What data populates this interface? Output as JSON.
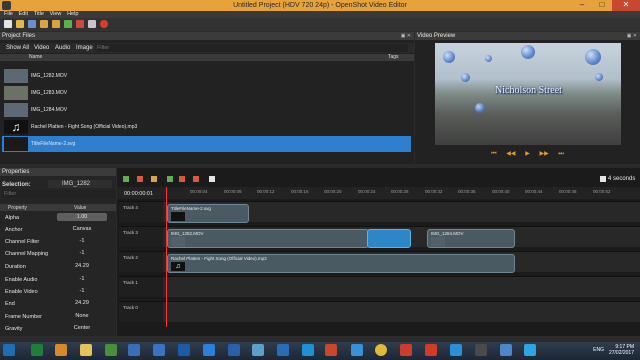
{
  "window": {
    "title": "Untitled Project (HDV 720 24p) - OpenShot Video Editor",
    "minimize": "–",
    "maximize": "□",
    "close": "✕"
  },
  "menu": {
    "file": "File",
    "edit": "Edit",
    "title": "Title",
    "view": "View",
    "help": "Help"
  },
  "project_files": {
    "header": "Project Files",
    "tabs": [
      "Show All",
      "Video",
      "Audio",
      "Image"
    ],
    "filter_placeholder": "Filter",
    "columns": {
      "name": "Name",
      "tags": "Tags"
    },
    "items": [
      "IMG_1282.MOV",
      "IMG_1283.MOV",
      "IMG_1284.MOV",
      "Rachel Platten - Fight Song (Official Video).mp3",
      "TitleFileName-2.svg"
    ]
  },
  "video_preview": {
    "header": "Video Preview",
    "overlay_text": "Nicholson Street",
    "transport": [
      "⏮",
      "◀◀",
      "▶",
      "▶▶",
      "⏭"
    ]
  },
  "properties": {
    "header": "Properties",
    "selection_label": "Selection:",
    "selection_value": "IMG_1282",
    "filter_placeholder": "Filter",
    "columns": {
      "property": "Property",
      "value": "Value"
    },
    "rows": [
      {
        "k": "Alpha",
        "v": "1.00"
      },
      {
        "k": "Anchor",
        "v": "Canvas"
      },
      {
        "k": "Channel Filter",
        "v": "-1"
      },
      {
        "k": "Channel Mapping",
        "v": "-1"
      },
      {
        "k": "Duration",
        "v": "24.29"
      },
      {
        "k": "Enable Audio",
        "v": "-1"
      },
      {
        "k": "Enable Video",
        "v": "-1"
      },
      {
        "k": "End",
        "v": "24.29"
      },
      {
        "k": "Frame Number",
        "v": "None"
      },
      {
        "k": "Gravity",
        "v": "Center"
      }
    ]
  },
  "timeline": {
    "zoom_label": "4 seconds",
    "timecode": "00:00:00:01",
    "ticks": [
      "00:00:04",
      "00:00:08",
      "00:00:12",
      "00:00:16",
      "00:00:20",
      "00:00:24",
      "00:00:28",
      "00:00:32",
      "00:00:36",
      "00:00:40",
      "00:00:44",
      "00:00:48",
      "00:00:52"
    ],
    "tracks": [
      {
        "name": "Track 4",
        "clips": [
          {
            "label": "TitleFileName-2.svg"
          }
        ]
      },
      {
        "name": "Track 3",
        "clips": [
          {
            "label": "IMG_1282.MOV"
          },
          {
            "label": ""
          },
          {
            "label": "IMG_1284.MOV"
          }
        ]
      },
      {
        "name": "Track 2",
        "clips": [
          {
            "label": "Rachel Platten - Fight Song (Official Video).mp3"
          }
        ]
      },
      {
        "name": "Track 1",
        "clips": []
      },
      {
        "name": "Track 0",
        "clips": []
      }
    ]
  },
  "taskbar": {
    "lang": "ENG",
    "time": "9:17 PM",
    "date": "27/02/2017"
  }
}
